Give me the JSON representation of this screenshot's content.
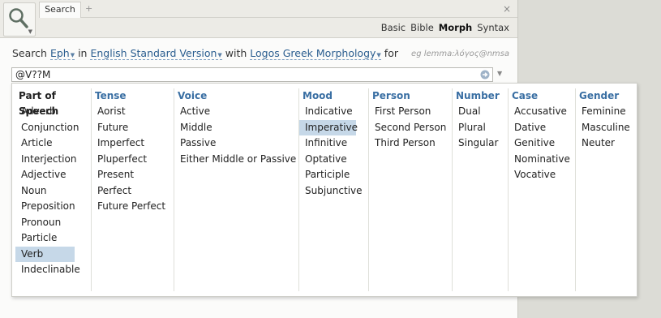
{
  "toolbar": {
    "tab_label": "Search",
    "add_tab": "+",
    "close": "×",
    "modes": [
      {
        "label": "Basic",
        "active": false
      },
      {
        "label": "Bible",
        "active": false
      },
      {
        "label": "Morph",
        "active": true
      },
      {
        "label": "Syntax",
        "active": false
      }
    ]
  },
  "search_line": {
    "prefix": "Search",
    "range": "Eph",
    "in_word": "in",
    "version": "English Standard Version",
    "with_word": "with",
    "morphology": "Logos Greek Morphology",
    "for_word": "for",
    "example": "eg lemma:λόγος@nmsa"
  },
  "query": {
    "value": "@V??M"
  },
  "colors": {
    "accent": "#3a6fa3",
    "selected": "#c6d8e8"
  },
  "categories": [
    {
      "header": "Part of Speech",
      "selected": 9,
      "items": [
        "Adverb",
        "Conjunction",
        "Article",
        "Interjection",
        "Adjective",
        "Noun",
        "Preposition",
        "Pronoun",
        "Particle",
        "Verb",
        "Indeclinable"
      ]
    },
    {
      "header": "Tense",
      "selected": -1,
      "items": [
        "Aorist",
        "Future",
        "Imperfect",
        "Pluperfect",
        "Present",
        "Perfect",
        "Future Perfect"
      ]
    },
    {
      "header": "Voice",
      "selected": -1,
      "items": [
        "Active",
        "Middle",
        "Passive",
        "Either Middle or Passive"
      ]
    },
    {
      "header": "Mood",
      "selected": 1,
      "items": [
        "Indicative",
        "Imperative",
        "Infinitive",
        "Optative",
        "Participle",
        "Subjunctive"
      ]
    },
    {
      "header": "Person",
      "selected": -1,
      "items": [
        "First Person",
        "Second Person",
        "Third Person"
      ]
    },
    {
      "header": "Number",
      "selected": -1,
      "items": [
        "Dual",
        "Plural",
        "Singular"
      ]
    },
    {
      "header": "Case",
      "selected": -1,
      "items": [
        "Accusative",
        "Dative",
        "Genitive",
        "Nominative",
        "Vocative"
      ]
    },
    {
      "header": "Gender",
      "selected": -1,
      "items": [
        "Feminine",
        "Masculine",
        "Neuter"
      ]
    }
  ]
}
